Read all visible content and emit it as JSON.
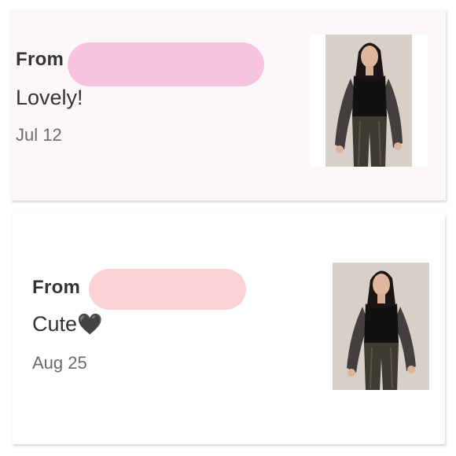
{
  "messages": [
    {
      "from_label": "From",
      "text": "Lovely!",
      "date": "Jul 12",
      "redaction_color": "#f6c4dc"
    },
    {
      "from_label": "From",
      "text": "Cute",
      "emoji": "🖤",
      "date": "Aug 25",
      "redaction_color": "#fbd2d3"
    }
  ],
  "colors": {
    "text": "#333333",
    "date": "#6a6a6a",
    "card1_bg": "#fcf8fa",
    "card2_bg": "#ffffff"
  }
}
